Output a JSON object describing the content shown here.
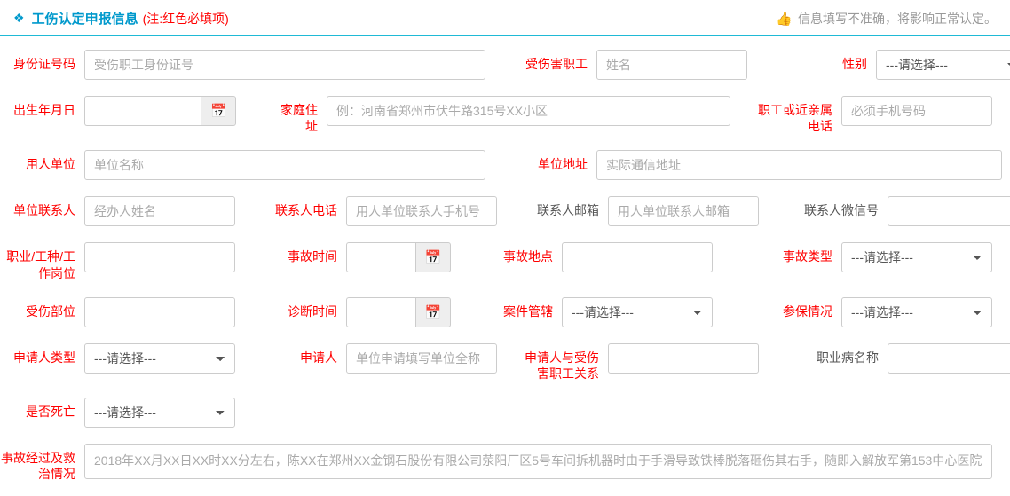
{
  "header": {
    "title": "工伤认定申报信息",
    "note": "(注:红色必填项)",
    "warning": "信息填写不准确，将影响正常认定。"
  },
  "labels": {
    "idcard": "身份证号码",
    "name": "受伤害职工",
    "gender": "性别",
    "birth": "出生年月日",
    "homeaddr": "家庭住址",
    "relphone": "职工或近亲属电话",
    "employer": "用人单位",
    "unitaddr": "单位地址",
    "unitcontact": "单位联系人",
    "contactphone": "联系人电话",
    "contactemail": "联系人邮箱",
    "contactwechat": "联系人微信号",
    "occupation": "职业/工种/工作岗位",
    "accidenttime": "事故时间",
    "accidentplace": "事故地点",
    "accidenttype": "事故类型",
    "injurypart": "受伤部位",
    "diagnosistime": "诊断时间",
    "casejurisdiction": "案件管辖",
    "insurance": "参保情况",
    "applicanttype": "申请人类型",
    "applicant": "申请人",
    "applicantrelation": "申请人与受伤害职工关系",
    "diseasename": "职业病名称",
    "isdead": "是否死亡",
    "process": "事故经过及救治情况"
  },
  "placeholders": {
    "idcard": "受伤职工身份证号",
    "name": "姓名",
    "homeaddr": "例：河南省郑州市伏牛路315号XX小区",
    "relphone": "必须手机号码",
    "employer": "单位名称",
    "unitaddr": "实际通信地址",
    "unitcontact": "经办人姓名",
    "contactphone": "用人单位联系人手机号",
    "contactemail": "用人单位联系人邮箱",
    "applicant": "单位申请填写单位全称",
    "process": "2018年XX月XX日XX时XX分左右，陈XX在郑州XX金钢石股份有限公司荥阳厂区5号车间拆机器时由于手滑导致铁棒脱落砸伤其右手，随即入解放军第153中心医院"
  },
  "select": {
    "placeholder": "---请选择---"
  }
}
